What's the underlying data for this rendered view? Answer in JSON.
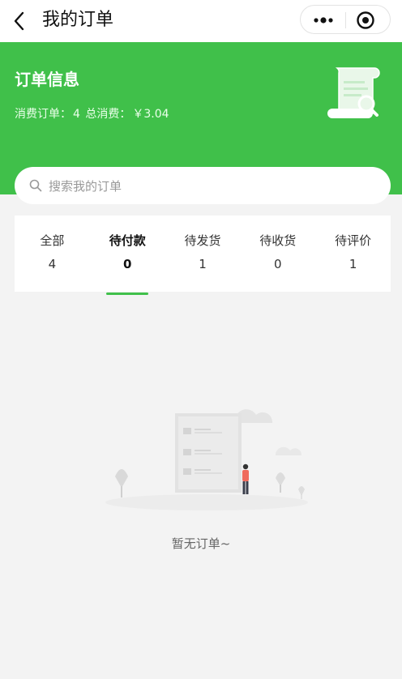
{
  "navbar": {
    "title": "我的订单"
  },
  "hero": {
    "title": "订单信息",
    "summary_label": "消费订单：",
    "order_count": "4",
    "total_label": "总消费：",
    "total_amount": "￥3.04"
  },
  "search": {
    "placeholder": "搜索我的订单"
  },
  "tabs": [
    {
      "label": "全部",
      "count": "4",
      "active": false
    },
    {
      "label": "待付款",
      "count": "0",
      "active": true
    },
    {
      "label": "待发货",
      "count": "1",
      "active": false
    },
    {
      "label": "待收货",
      "count": "0",
      "active": false
    },
    {
      "label": "待评价",
      "count": "1",
      "active": false
    }
  ],
  "empty_state": {
    "message": "暂无订单~"
  },
  "colors": {
    "brand_green": "#40c04a",
    "background": "#f3f3f3"
  },
  "icons": [
    "back-arrow-icon",
    "more-dots-icon",
    "target-icon",
    "scroll-document-icon",
    "search-icon"
  ]
}
